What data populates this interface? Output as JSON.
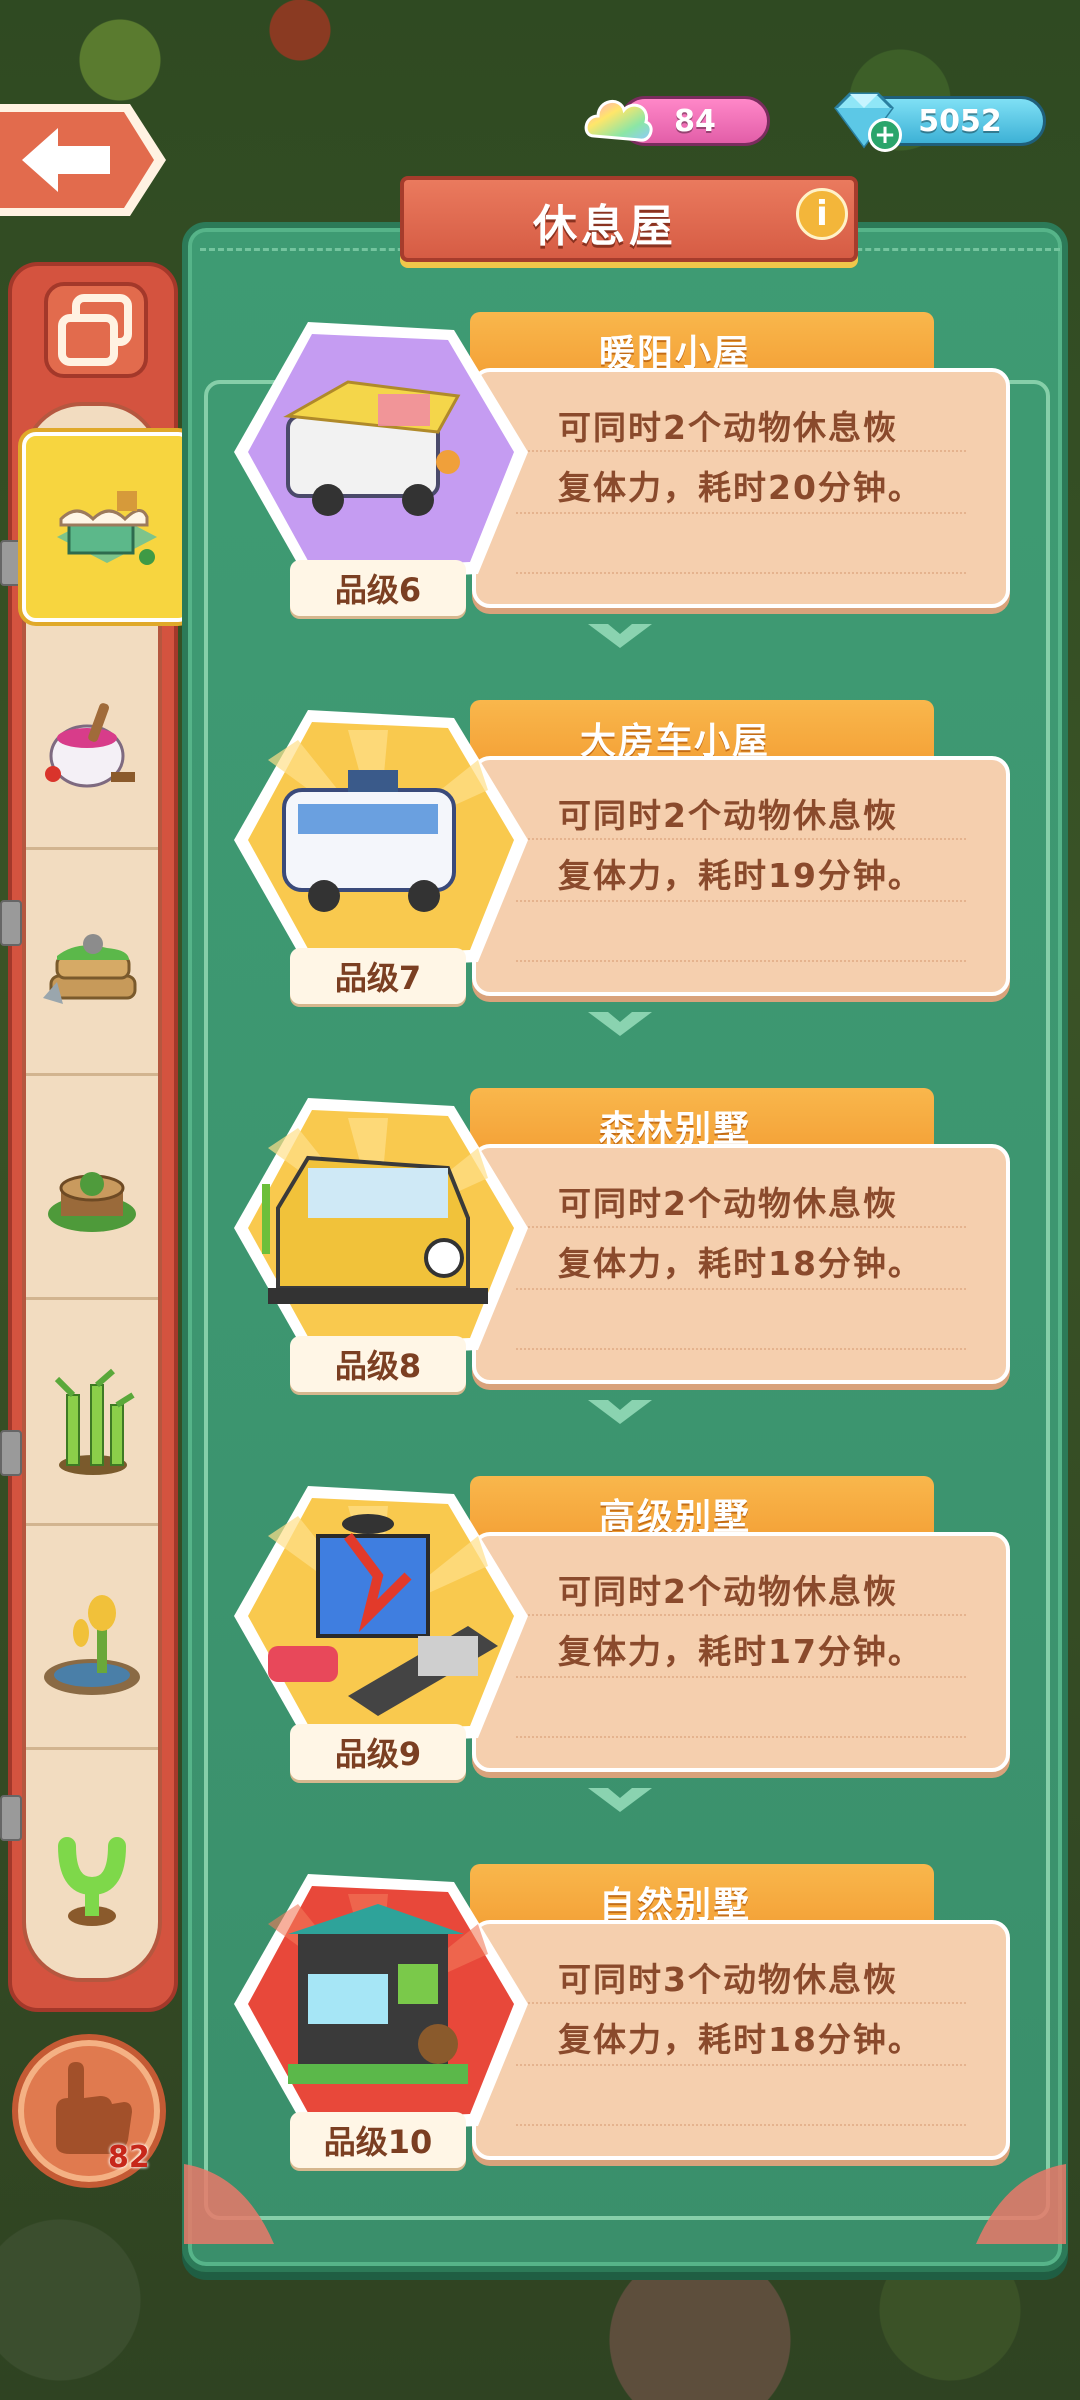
{
  "header": {
    "title": "休息屋",
    "info_label": "i"
  },
  "currencies": {
    "energy": {
      "value": "84",
      "icon": "rainbow-cloud-icon",
      "color": "#e25ea8"
    },
    "gems": {
      "value": "5052",
      "icon": "diamond-icon",
      "color": "#3db1d6",
      "plus": "+"
    }
  },
  "sidebar": {
    "items": [
      {
        "icon": "rest-house-icon",
        "active": true
      },
      {
        "icon": "cooking-pot-icon",
        "active": false
      },
      {
        "icon": "log-pile-icon",
        "active": false
      },
      {
        "icon": "stump-icon",
        "active": false
      },
      {
        "icon": "bamboo-icon",
        "active": false
      },
      {
        "icon": "pond-icon",
        "active": false
      },
      {
        "icon": "cactus-icon",
        "active": false
      }
    ],
    "hand_count": "82"
  },
  "cards": [
    {
      "name": "暖阳小屋",
      "desc_line1": "可同时2个动物休息恢",
      "desc_line2": "复体力，耗时20分钟。",
      "grade": "品级6",
      "hex_color": "#c59cf2"
    },
    {
      "name": "大房车小屋",
      "desc_line1": "可同时2个动物休息恢",
      "desc_line2": "复体力，耗时19分钟。",
      "grade": "品级7",
      "hex_color": "#f9c94e"
    },
    {
      "name": "森林别墅",
      "desc_line1": "可同时2个动物休息恢",
      "desc_line2": "复体力，耗时18分钟。",
      "grade": "品级8",
      "hex_color": "#f9c94e"
    },
    {
      "name": "高级别墅",
      "desc_line1": "可同时2个动物休息恢",
      "desc_line2": "复体力，耗时17分钟。",
      "grade": "品级9",
      "hex_color": "#f9c94e"
    },
    {
      "name": "自然别墅",
      "desc_line1": "可同时3个动物休息恢",
      "desc_line2": "复体力，耗时18分钟。",
      "grade": "品级10",
      "hex_color": "#e8483a"
    }
  ]
}
